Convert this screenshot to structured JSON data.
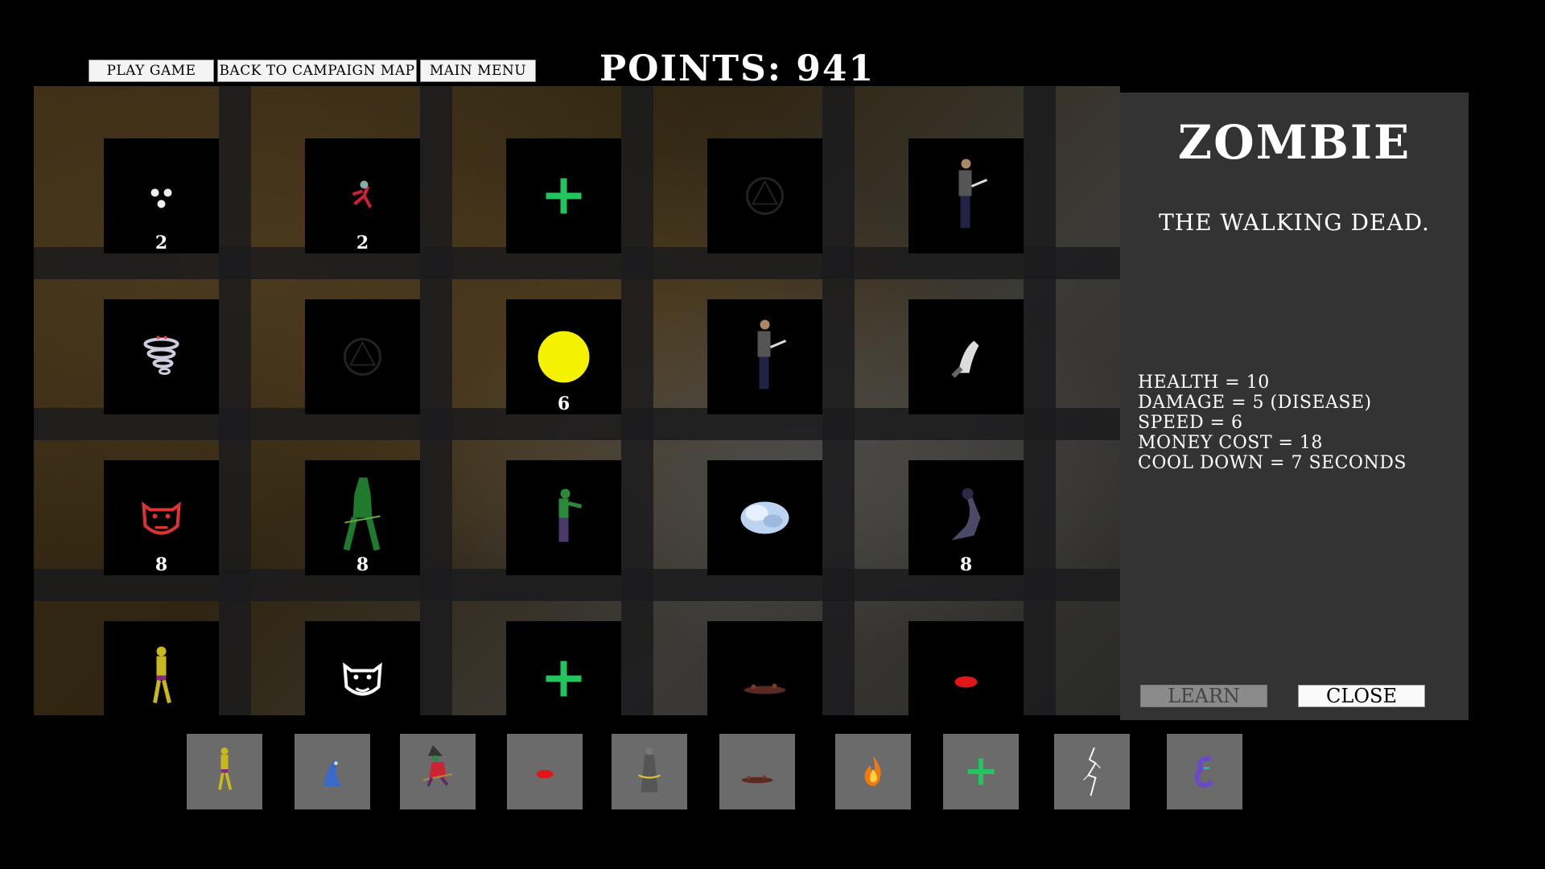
{
  "toolbar": {
    "play": "PLAY GAME",
    "campaign": "BACK TO CAMPAIGN MAP",
    "menu": "MAIN MENU"
  },
  "points": "POINTS: 941",
  "grid": [
    [
      {
        "icon": "three-orbs-icon",
        "count": "2"
      },
      {
        "icon": "red-imp-icon",
        "count": "2"
      },
      {
        "icon": "green-plus-icon",
        "count": ""
      },
      {
        "icon": "dark-sigil-icon",
        "count": ""
      },
      {
        "icon": "swordsman-icon",
        "count": ""
      }
    ],
    [
      {
        "icon": "whirlwind-icon",
        "count": ""
      },
      {
        "icon": "dark-sigil-icon",
        "count": ""
      },
      {
        "icon": "yellow-sun-icon",
        "count": "6"
      },
      {
        "icon": "swordsman-icon",
        "count": ""
      },
      {
        "icon": "ghost-icon",
        "count": ""
      }
    ],
    [
      {
        "icon": "demon-mask-icon",
        "count": "8"
      },
      {
        "icon": "green-hooded-icon",
        "count": "8"
      },
      {
        "icon": "zombie-icon",
        "count": ""
      },
      {
        "icon": "frost-cloud-icon",
        "count": ""
      },
      {
        "icon": "shadow-wraith-icon",
        "count": "8"
      }
    ],
    [
      {
        "icon": "yellow-walker-icon",
        "count": ""
      },
      {
        "icon": "white-mask-icon",
        "count": ""
      },
      {
        "icon": "green-plus-icon",
        "count": ""
      },
      {
        "icon": "blood-splatter-icon",
        "count": ""
      },
      {
        "icon": "red-blob-icon",
        "count": ""
      }
    ]
  ],
  "panel": {
    "name": "ZOMBIE",
    "description": "THE WALKING DEAD.",
    "stats": [
      "HEALTH = 10",
      "DAMAGE = 5 (DISEASE)",
      "SPEED = 6",
      "MONEY COST = 18",
      "COOL DOWN = 7 SECONDS"
    ],
    "learn": "LEARN",
    "close": "CLOSE"
  },
  "hotbar": [
    "yellow-walker-icon",
    "blue-wave-icon",
    "witch-icon",
    "red-blob-icon",
    "robed-mage-icon",
    "blood-splatter-icon",
    "fire-icon",
    "green-plus-icon",
    "lightning-icon",
    "purple-rune-icon"
  ],
  "colors": {
    "panel_bg": "#333333",
    "slot_bg": "#6b6b6b",
    "plus_green": "#22c55e",
    "sun_yellow": "#f5f200"
  }
}
